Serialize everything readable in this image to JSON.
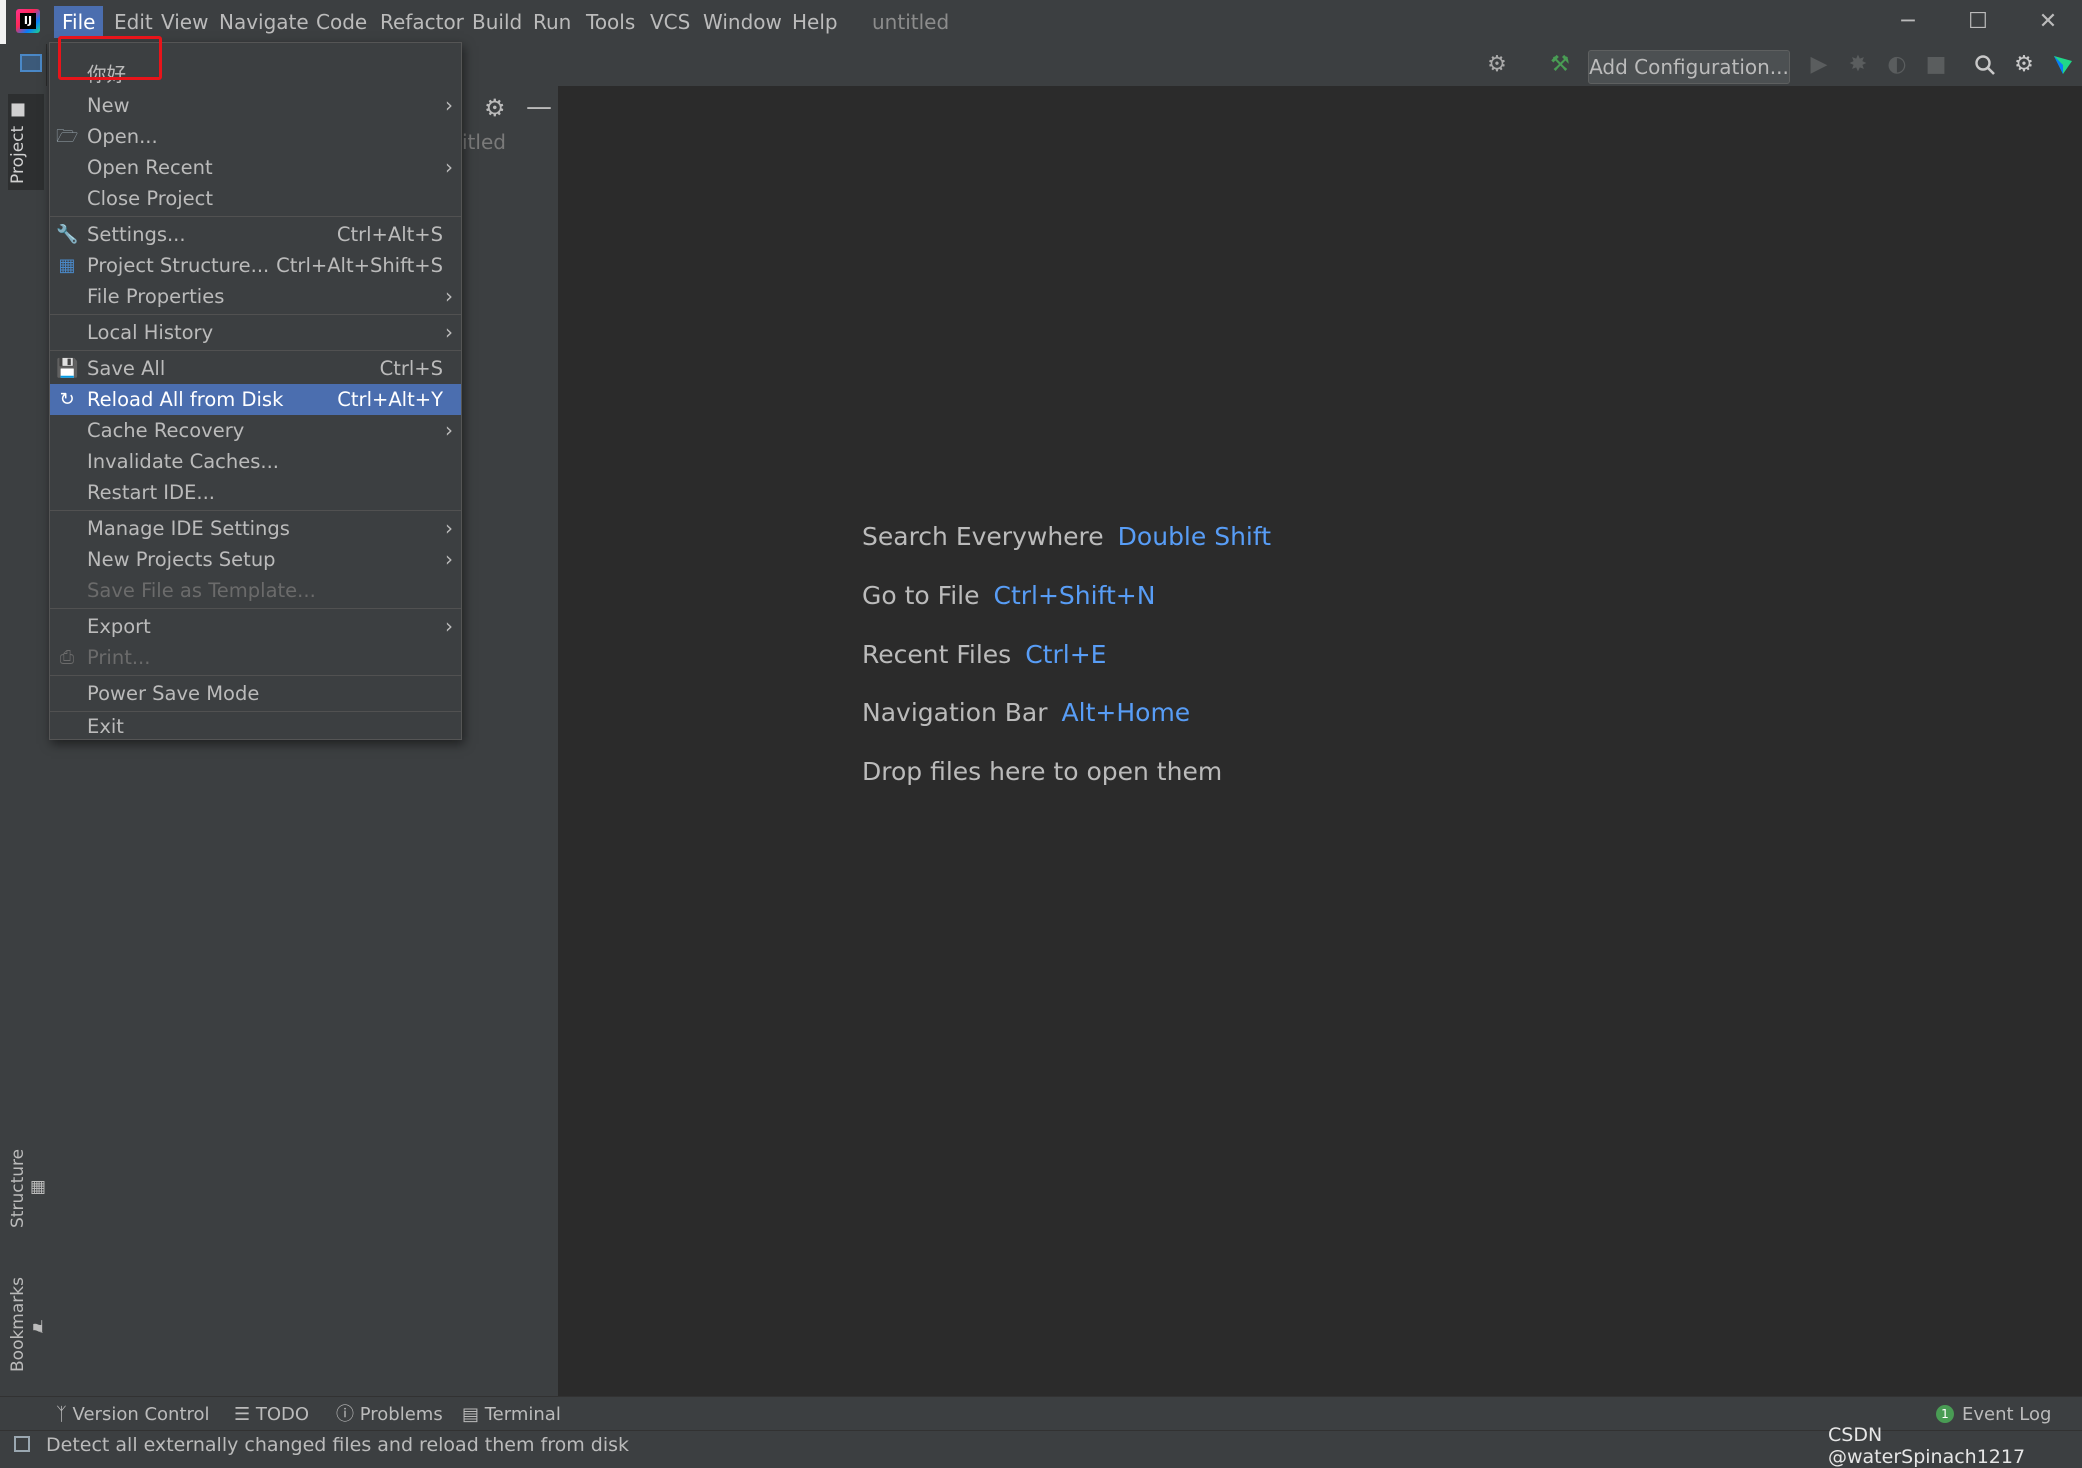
{
  "menubar": {
    "items": [
      "File",
      "Edit",
      "View",
      "Navigate",
      "Code",
      "Refactor",
      "Build",
      "Run",
      "Tools",
      "VCS",
      "Window",
      "Help"
    ],
    "project_name": "untitled"
  },
  "window_controls": {
    "minimize": "─",
    "maximize": "☐",
    "close": "✕"
  },
  "toolbar": {
    "add_configuration": "Add Configuration..."
  },
  "left_strip": {
    "project_tab": "Project",
    "structure_tab": "Structure",
    "bookmarks_tab": "Bookmarks"
  },
  "project_panel": {
    "title_fragment": "itled"
  },
  "file_menu": {
    "items": [
      {
        "label": "你好"
      },
      {
        "label": "New",
        "submenu": true
      },
      {
        "label": "Open...",
        "icon": "folder-icon"
      },
      {
        "label": "Open Recent",
        "submenu": true
      },
      {
        "label": "Close Project"
      },
      {
        "label": "Settings...",
        "shortcut": "Ctrl+Alt+S",
        "icon": "wrench-icon"
      },
      {
        "label": "Project Structure...",
        "shortcut": "Ctrl+Alt+Shift+S",
        "icon": "project-structure-icon"
      },
      {
        "label": "File Properties",
        "submenu": true
      },
      {
        "label": "Local History",
        "submenu": true
      },
      {
        "label": "Save All",
        "shortcut": "Ctrl+S",
        "icon": "save-icon"
      },
      {
        "label": "Reload All from Disk",
        "shortcut": "Ctrl+Alt+Y",
        "icon": "reload-icon",
        "highlighted": true
      },
      {
        "label": "Cache Recovery",
        "submenu": true
      },
      {
        "label": "Invalidate Caches..."
      },
      {
        "label": "Restart IDE..."
      },
      {
        "label": "Manage IDE Settings",
        "submenu": true
      },
      {
        "label": "New Projects Setup",
        "submenu": true
      },
      {
        "label": "Save File as Template...",
        "disabled": true
      },
      {
        "label": "Export",
        "submenu": true
      },
      {
        "label": "Print...",
        "icon": "printer-icon",
        "disabled": true
      },
      {
        "label": "Power Save Mode"
      },
      {
        "label": "Exit"
      }
    ]
  },
  "editor_hints": [
    {
      "text": "Search Everywhere",
      "key": "Double Shift"
    },
    {
      "text": "Go to File",
      "key": "Ctrl+Shift+N"
    },
    {
      "text": "Recent Files",
      "key": "Ctrl+E"
    },
    {
      "text": "Navigation Bar",
      "key": "Alt+Home"
    },
    {
      "text": "Drop files here to open them",
      "key": ""
    }
  ],
  "bottom_tabs": [
    "Version Control",
    "TODO",
    "Problems",
    "Terminal"
  ],
  "event_log": {
    "label": "Event Log",
    "count": "1"
  },
  "status_bar": {
    "message": "Detect all externally changed files and reload them from disk"
  },
  "watermark": "CSDN @waterSpinach1217",
  "colors": {
    "highlight": "#4b6eaf",
    "link": "#589df6",
    "annotation": "#e8141a"
  }
}
